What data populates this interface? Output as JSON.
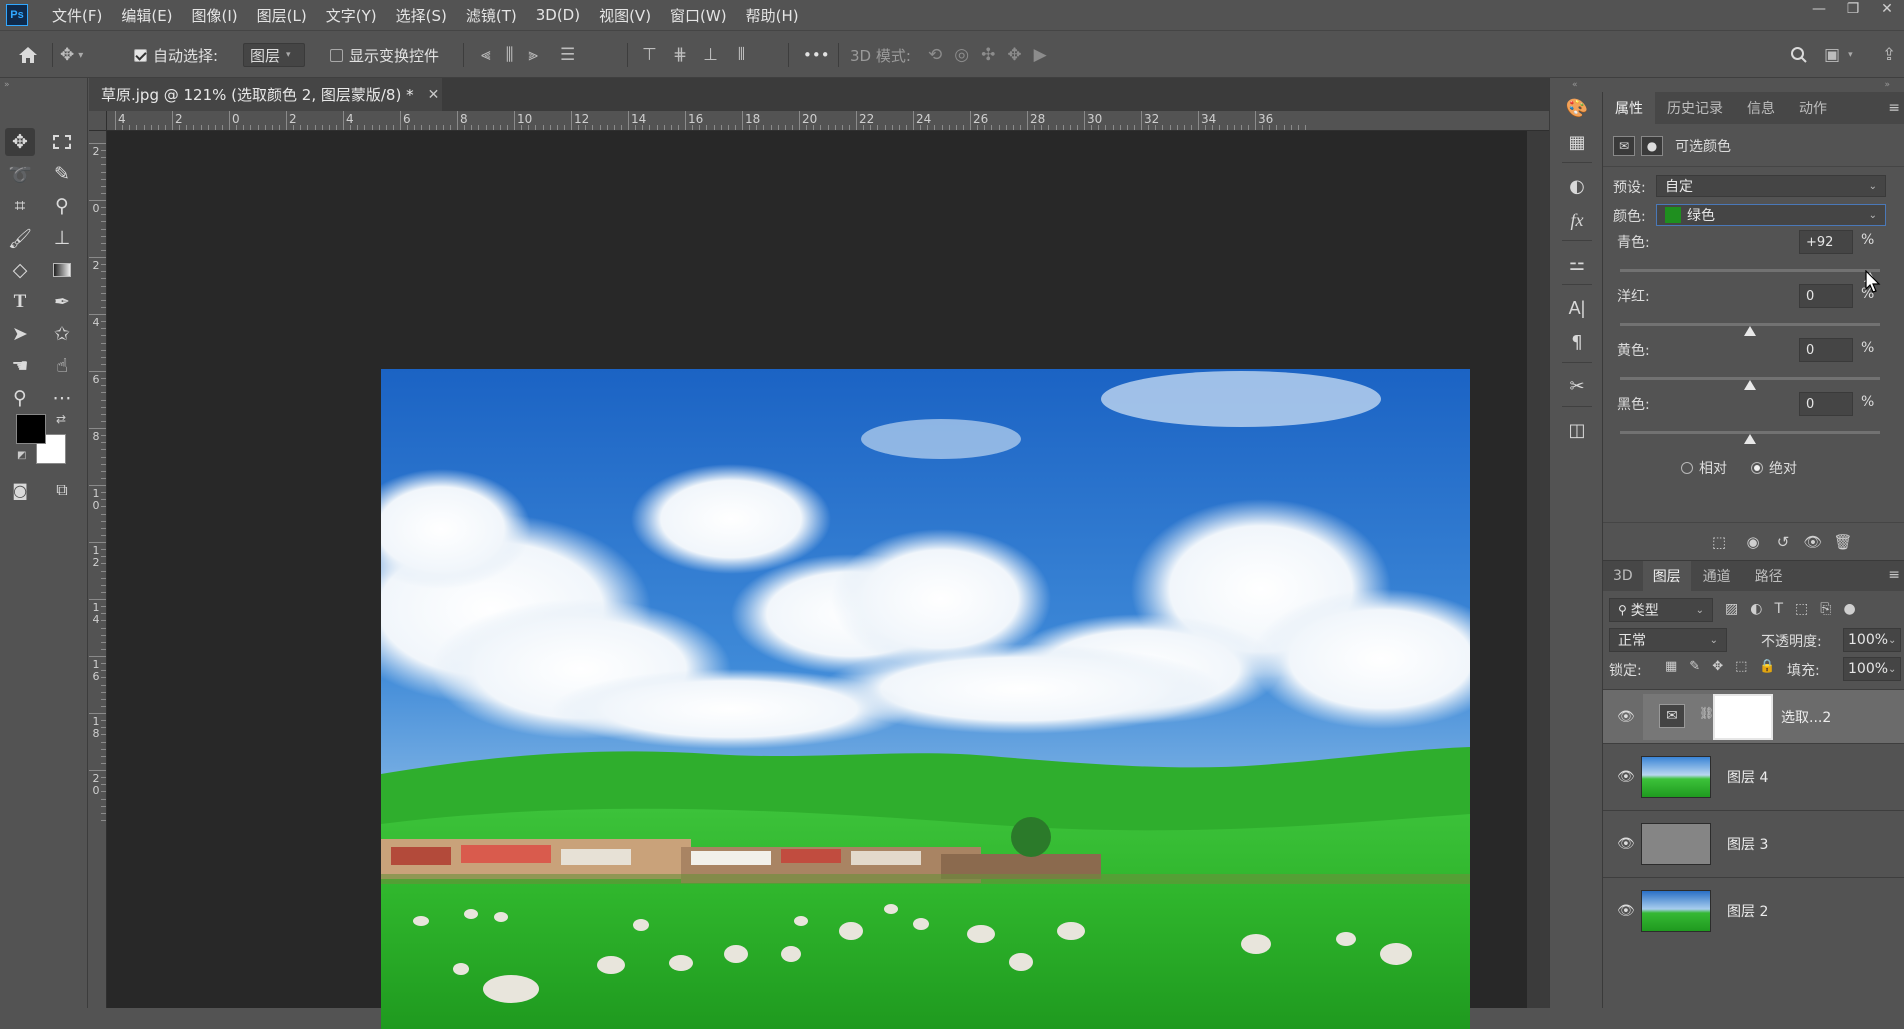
{
  "app": {
    "logo": "Ps",
    "menu": [
      "文件(F)",
      "编辑(E)",
      "图像(I)",
      "图层(L)",
      "文字(Y)",
      "选择(S)",
      "滤镜(T)",
      "3D(D)",
      "视图(V)",
      "窗口(W)",
      "帮助(H)"
    ],
    "window_controls": {
      "minimize": "—",
      "restore": "❐",
      "close": "✕"
    }
  },
  "options_bar": {
    "auto_select_label": "自动选择:",
    "auto_select_checked": true,
    "auto_select_target": "图层",
    "show_transform_label": "显示变换控件",
    "show_transform_checked": false,
    "mode_3d_label": "3D 模式:",
    "more": "•••"
  },
  "document": {
    "tab_title": "草原.jpg @ 121% (选取颜色 2, 图层蒙版/8) *",
    "close": "✕",
    "ruler_h_labels": [
      "4",
      "2",
      "0",
      "2",
      "4",
      "6",
      "8",
      "10",
      "12",
      "14",
      "16",
      "18",
      "20",
      "22",
      "24",
      "26",
      "28",
      "30",
      "32",
      "34",
      "36"
    ],
    "ruler_v_labels": [
      "2",
      "0",
      "2",
      "4",
      "6",
      "8",
      "10",
      "12",
      "14",
      "16",
      "18",
      "20"
    ]
  },
  "tools": {
    "fg_color": "#000000",
    "bg_color": "#ffffff"
  },
  "properties_panel": {
    "tabs": [
      "属性",
      "历史记录",
      "信息",
      "动作"
    ],
    "active_tab": "属性",
    "adjustment_title": "可选颜色",
    "preset_label": "预设:",
    "preset_value": "自定",
    "color_label": "颜色:",
    "color_value": "绿色",
    "color_swatch": "#1f8f1f",
    "sliders": [
      {
        "label": "青色:",
        "value": "+92",
        "unit": "%",
        "level": 0.96
      },
      {
        "label": "洋红:",
        "value": "0",
        "unit": "%",
        "level": 0.5
      },
      {
        "label": "黄色:",
        "value": "0",
        "unit": "%",
        "level": 0.5
      },
      {
        "label": "黑色:",
        "value": "0",
        "unit": "%",
        "level": 0.5
      }
    ],
    "method_relative": "相对",
    "method_absolute": "绝对",
    "method_selected": "绝对"
  },
  "layers_panel": {
    "tabs": [
      "3D",
      "图层",
      "通道",
      "路径"
    ],
    "active_tab": "图层",
    "filter_label": "类型",
    "blend_mode": "正常",
    "opacity_label": "不透明度:",
    "opacity_value": "100%",
    "lock_label": "锁定:",
    "fill_label": "填充:",
    "fill_value": "100%",
    "layers": [
      {
        "name": "选取...2",
        "type": "adjustment",
        "visible": true,
        "selected": true
      },
      {
        "name": "图层 4",
        "type": "image",
        "visible": true,
        "selected": false
      },
      {
        "name": "图层 3",
        "type": "gray",
        "visible": true,
        "selected": false
      },
      {
        "name": "图层 2",
        "type": "image",
        "visible": true,
        "selected": false
      }
    ]
  }
}
